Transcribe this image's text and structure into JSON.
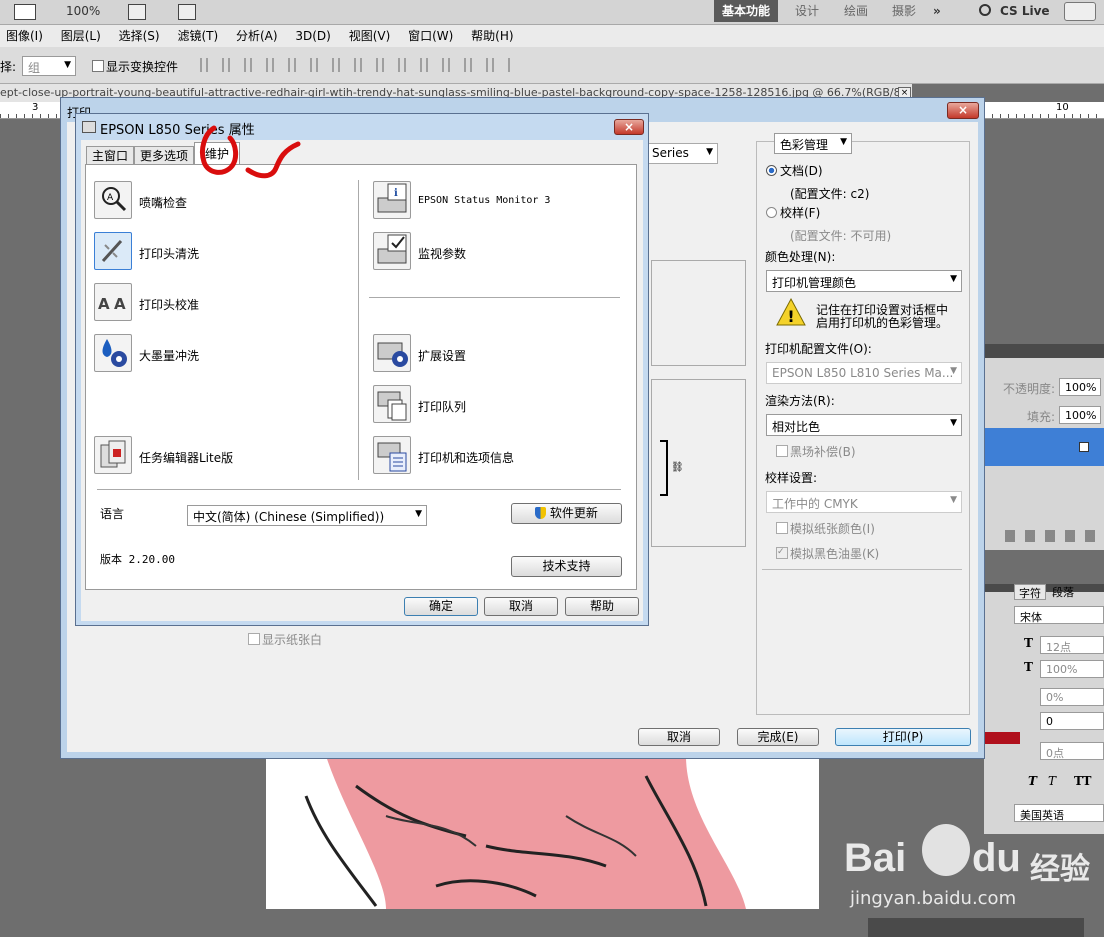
{
  "ps": {
    "topbar": {
      "zoom": "100%",
      "workspace_active": "基本功能",
      "workspaces": [
        "设计",
        "绘画",
        "摄影"
      ],
      "more": "»",
      "cslive": "CS Live"
    },
    "menu": [
      "图像(I)",
      "图层(L)",
      "选择(S)",
      "滤镜(T)",
      "分析(A)",
      "3D(D)",
      "视图(V)",
      "窗口(W)",
      "帮助(H)"
    ],
    "options": {
      "select_label": "择:",
      "select_value": "组",
      "show_transform": "显示变换控件"
    },
    "doc_tab": "ept-close-up-portrait-young-beautiful-attractive-redhair-girl-wtih-trendy-hat-sunglass-smiling-blue-pastel-background-copy-space-1258-128516.jpg @ 66.7%(RGB/8)",
    "ruler": {
      "r3": "3",
      "r10": "10"
    },
    "layers": {
      "opacity_label": "不透明度:",
      "opacity": "100%",
      "fill_label": "填充:",
      "fill": "100%"
    },
    "char_panel": {
      "tab_char": "字符",
      "tab_para": "段落",
      "font": "宋体",
      "size": "12点",
      "scale": "100%",
      "tracking": "0%",
      "kerning": "0",
      "baseline": "0点",
      "lang": "美国英语",
      "t1": "T",
      "t2": "T",
      "t3": "TT"
    }
  },
  "print_dialog": {
    "title": "打印",
    "printer_tail": "Series",
    "color_mgmt_label": "色彩管理",
    "doc_radio": "文档(D)",
    "doc_profile": "(配置文件: c2)",
    "proof_radio": "校样(F)",
    "proof_profile": "(配置文件: 不可用)",
    "color_handling_label": "颜色处理(N):",
    "color_handling": "打印机管理颜色",
    "warning": "记住在打印设置对话框中启用打印机的色彩管理。",
    "printer_profile_label": "打印机配置文件(O):",
    "printer_profile": "EPSON L850 L810 Series Ma...",
    "render_label": "渲染方法(R):",
    "render": "相对比色",
    "bpc": "黑场补偿(B)",
    "proof_settings_label": "校样设置:",
    "proof_settings": "工作中的 CMYK",
    "sim_paper": "模拟纸张颜色(I)",
    "sim_ink": "模拟黑色油墨(K)",
    "show_white": "显示纸张白",
    "cancel": "取消",
    "done": "完成(E)",
    "print": "打印(P)"
  },
  "epson": {
    "title": "EPSON L850 Series 属性",
    "tabs": [
      "主窗口",
      "更多选项",
      "维护"
    ],
    "items_left": [
      "喷嘴检查",
      "打印头清洗",
      "打印头校准",
      "大墨量冲洗",
      "任务编辑器Lite版"
    ],
    "items_right": [
      "EPSON Status Monitor 3",
      "监视参数",
      "扩展设置",
      "打印队列",
      "打印机和选项信息"
    ],
    "lang_label": "语言",
    "lang_value": "中文(简体) (Chinese (Simplified))",
    "update_btn": "软件更新",
    "version": "版本 2.20.00",
    "support_btn": "技术支持",
    "ok": "确定",
    "cancel": "取消",
    "help": "帮助"
  },
  "watermark": {
    "brand": "Bai",
    "brand2": "du",
    "cn": "经验",
    "url": "jingyan.baidu.com"
  },
  "colors": {
    "accent": "#3a7fd6",
    "annotation": "#d90d0d"
  }
}
